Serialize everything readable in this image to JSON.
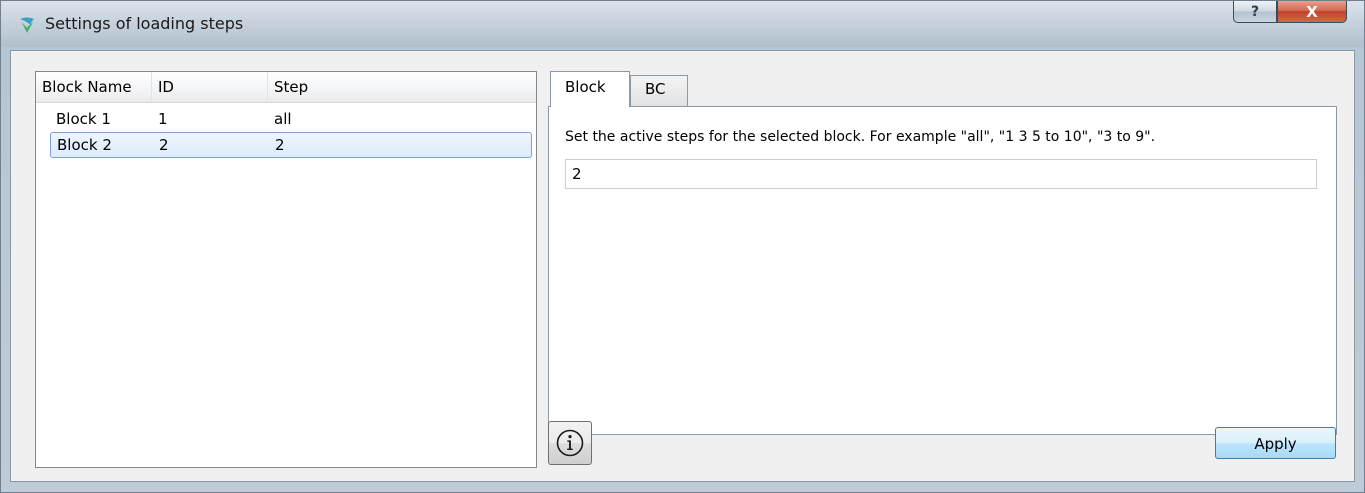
{
  "window": {
    "title": "Settings of loading steps",
    "help_label": "?",
    "close_label": "X"
  },
  "tree": {
    "columns": [
      "Block Name",
      "ID",
      "Step"
    ],
    "rows": [
      {
        "name": "Block 1",
        "id": "1",
        "step": "all",
        "selected": false
      },
      {
        "name": "Block 2",
        "id": "2",
        "step": "2",
        "selected": true
      }
    ]
  },
  "tabs": [
    {
      "label": "Block",
      "active": true
    },
    {
      "label": "BC",
      "active": false
    }
  ],
  "block_tab": {
    "hint": "Set the active steps for the selected block. For example \"all\", \"1 3 5 to 10\", \"3 to 9\".",
    "steps_value": "2"
  },
  "buttons": {
    "info_icon": "info-circle-icon",
    "apply_label": "Apply"
  },
  "colors": {
    "selection_fill": "#dcebfc",
    "selection_border": "#7da2ce",
    "close_button": "#c0432a",
    "apply_border": "#3c7fb1"
  }
}
